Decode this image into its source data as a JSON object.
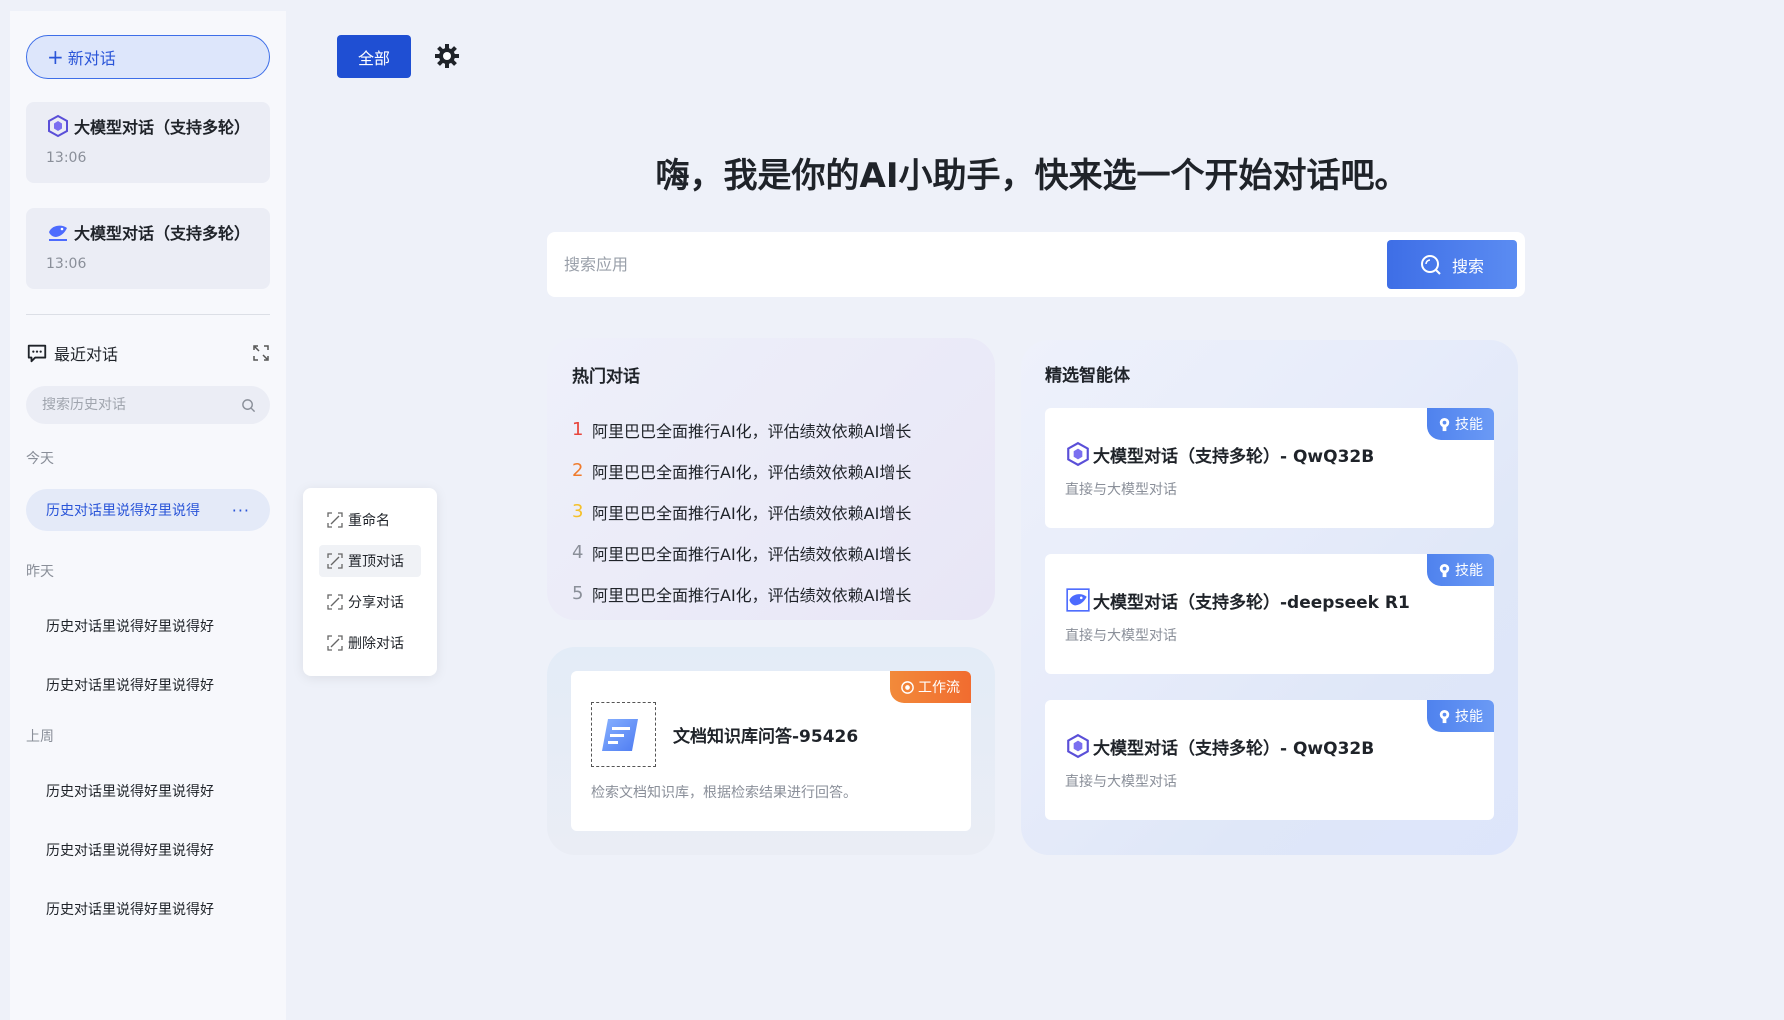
{
  "sidebar": {
    "new_chat": "新对话",
    "models": [
      {
        "title": "大模型对话（支持多轮）",
        "time": "13:06"
      },
      {
        "title": "大模型对话（支持多轮）",
        "time": "13:06"
      }
    ],
    "recent_title": "最近对话",
    "search_placeholder": "搜索历史对话",
    "groups": {
      "today": "今天",
      "yesterday": "昨天",
      "last_week": "上周"
    },
    "today_items": [
      "历史对话里说得好里说得"
    ],
    "yesterday_items": [
      "历史对话里说得好里说得好",
      "历史对话里说得好里说得好"
    ],
    "last_week_items": [
      "历史对话里说得好里说得好",
      "历史对话里说得好里说得好",
      "历史对话里说得好里说得好"
    ],
    "more": "···"
  },
  "context_menu": {
    "items": [
      "重命名",
      "置顶对话",
      "分享对话",
      "删除对话"
    ]
  },
  "toolbar": {
    "all_label": "全部"
  },
  "main": {
    "headline": "嗨，我是你的AI小助手，快来选一个开始对话吧。",
    "search_placeholder": "搜索应用",
    "search_button": "搜索",
    "hot": {
      "title": "热门对话",
      "items": [
        {
          "num": "1",
          "text": "阿里巴巴全面推行AI化，评估绩效依赖AI增长",
          "color": "#e8453c"
        },
        {
          "num": "2",
          "text": "阿里巴巴全面推行AI化，评估绩效依赖AI增长",
          "color": "#f07b2c"
        },
        {
          "num": "3",
          "text": "阿里巴巴全面推行AI化，评估绩效依赖AI增长",
          "color": "#f5c02a"
        },
        {
          "num": "4",
          "text": "阿里巴巴全面推行AI化，评估绩效依赖AI增长",
          "color": "#8a8f99"
        },
        {
          "num": "5",
          "text": "阿里巴巴全面推行AI化，评估绩效依赖AI增长",
          "color": "#8a8f99"
        }
      ]
    },
    "workflow": {
      "tag": "工作流",
      "name": "文档知识库问答-95426",
      "desc": "检索文档知识库，根据检索结果进行回答。"
    },
    "agents": {
      "title": "精选智能体",
      "tag": "技能",
      "items": [
        {
          "name": "大模型对话（支持多轮）- QwQ32B",
          "desc": "直接与大模型对话"
        },
        {
          "name": "大模型对话（支持多轮）-deepseek R1",
          "desc": "直接与大模型对话"
        },
        {
          "name": "大模型对话（支持多轮）- QwQ32B",
          "desc": "直接与大模型对话"
        }
      ]
    }
  },
  "colors": {
    "accent": "#1f4fd3",
    "link": "#2a55d8",
    "workflow_tag": "#f16c30",
    "skill_tag": "#4f82ee"
  }
}
